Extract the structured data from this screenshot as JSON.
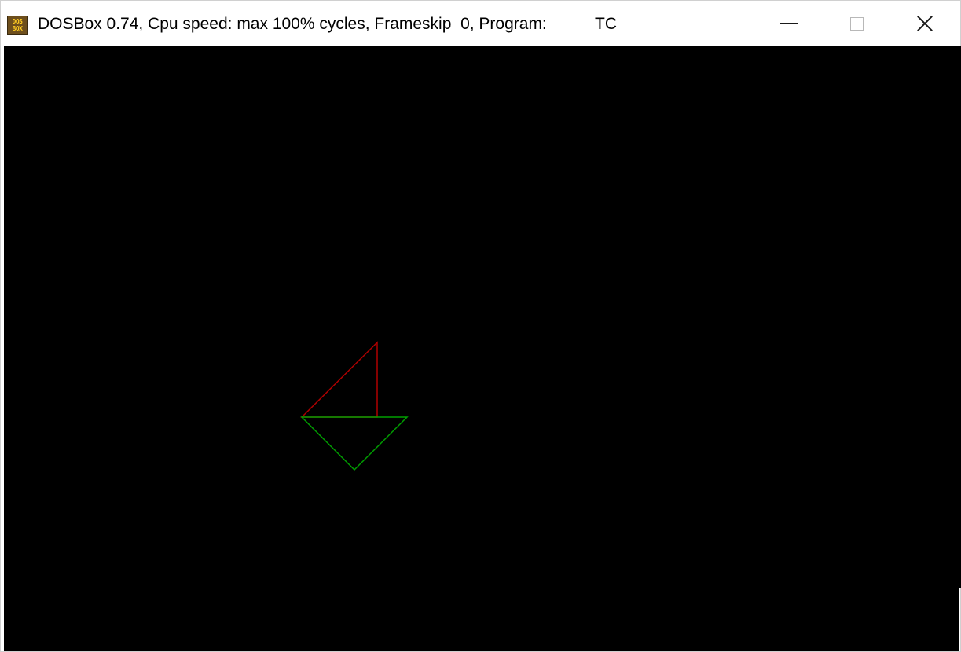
{
  "window": {
    "title": "DOSBox 0.74, Cpu speed: max 100% cycles, Frameskip  0, Program:",
    "program": "TC",
    "icon": {
      "name": "dosbox-icon",
      "line1": "DOS",
      "line2": "BOX"
    },
    "controls": {
      "minimize": "minimize-icon",
      "maximize": "maximize-icon",
      "close": "close-icon"
    }
  },
  "screen": {
    "background": "#000000",
    "shapes": [
      {
        "name": "red-triangle",
        "color": "#b00000"
      },
      {
        "name": "green-triangle",
        "color": "#00a000"
      }
    ]
  }
}
